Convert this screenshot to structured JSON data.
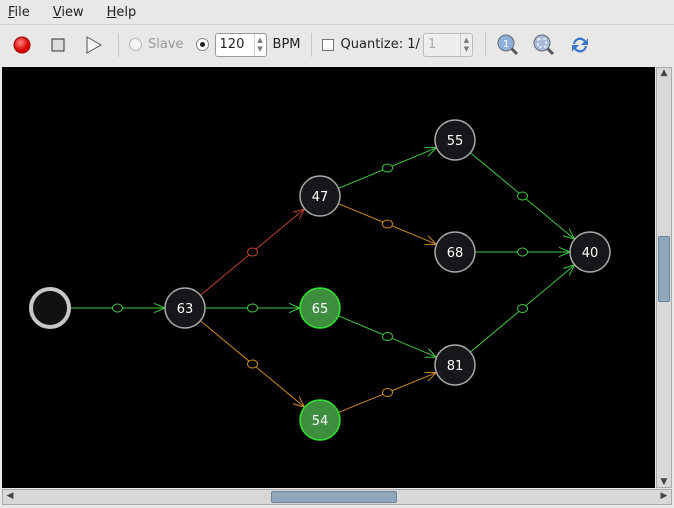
{
  "menu": [
    "File",
    "View",
    "Help"
  ],
  "toolbar": {
    "record": "record-icon",
    "stop": "stop-icon",
    "play": "play-icon",
    "slave_label": "Slave",
    "bpm_value": "120",
    "bpm_label": "BPM",
    "quantize_label": "Quantize: 1/",
    "quantize_value": "1",
    "zoom_reset": "zoom-1-icon",
    "zoom_fit": "zoom-fit-icon",
    "refresh": "refresh-icon"
  },
  "colors": {
    "green": "#3fc83f",
    "orange": "#d08a25",
    "red": "#c0452a",
    "active_node": "#3e8e40"
  },
  "graph": {
    "nodes": [
      {
        "id": "start",
        "label": "",
        "start": true
      },
      {
        "id": "63",
        "label": "63"
      },
      {
        "id": "47",
        "label": "47"
      },
      {
        "id": "65",
        "label": "65",
        "active": true
      },
      {
        "id": "54",
        "label": "54",
        "active": true
      },
      {
        "id": "55",
        "label": "55"
      },
      {
        "id": "68",
        "label": "68"
      },
      {
        "id": "81",
        "label": "81"
      },
      {
        "id": "40",
        "label": "40"
      }
    ],
    "edges": [
      {
        "from": "start",
        "to": "63",
        "color": "green"
      },
      {
        "from": "63",
        "to": "47",
        "color": "red"
      },
      {
        "from": "63",
        "to": "65",
        "color": "green"
      },
      {
        "from": "63",
        "to": "54",
        "color": "orange"
      },
      {
        "from": "47",
        "to": "55",
        "color": "green"
      },
      {
        "from": "47",
        "to": "68",
        "color": "orange"
      },
      {
        "from": "65",
        "to": "81",
        "color": "green"
      },
      {
        "from": "54",
        "to": "81",
        "color": "orange"
      },
      {
        "from": "55",
        "to": "40",
        "color": "green"
      },
      {
        "from": "68",
        "to": "40",
        "color": "green"
      },
      {
        "from": "81",
        "to": "40",
        "color": "green"
      }
    ]
  }
}
